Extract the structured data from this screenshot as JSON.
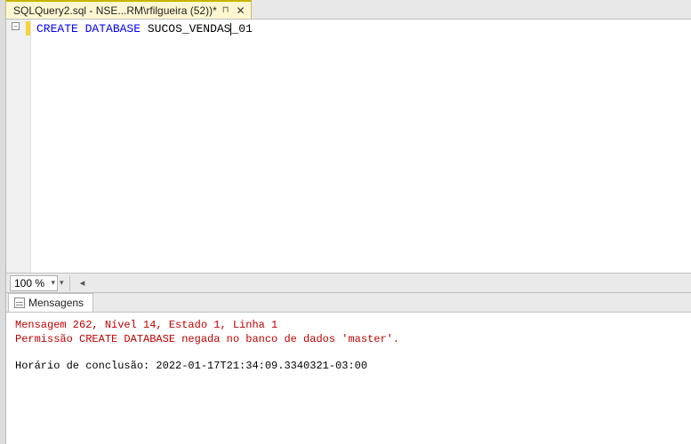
{
  "tab": {
    "title": "SQLQuery2.sql - NSE...RM\\rfilgueira (52))*"
  },
  "editor": {
    "keyword1": "CREATE",
    "keyword2": "DATABASE",
    "ident_before": "SUCOS_VENDAS",
    "ident_after": "_01"
  },
  "zoom": {
    "value": "100 %"
  },
  "results": {
    "tab_label": "Mensagens",
    "error_line1": "Mensagem 262, Nível 14, Estado 1, Linha 1",
    "error_line2": "Permissão CREATE DATABASE negada no banco de dados 'master'.",
    "completion": "Horário de conclusão: 2022-01-17T21:34:09.3340321-03:00"
  }
}
